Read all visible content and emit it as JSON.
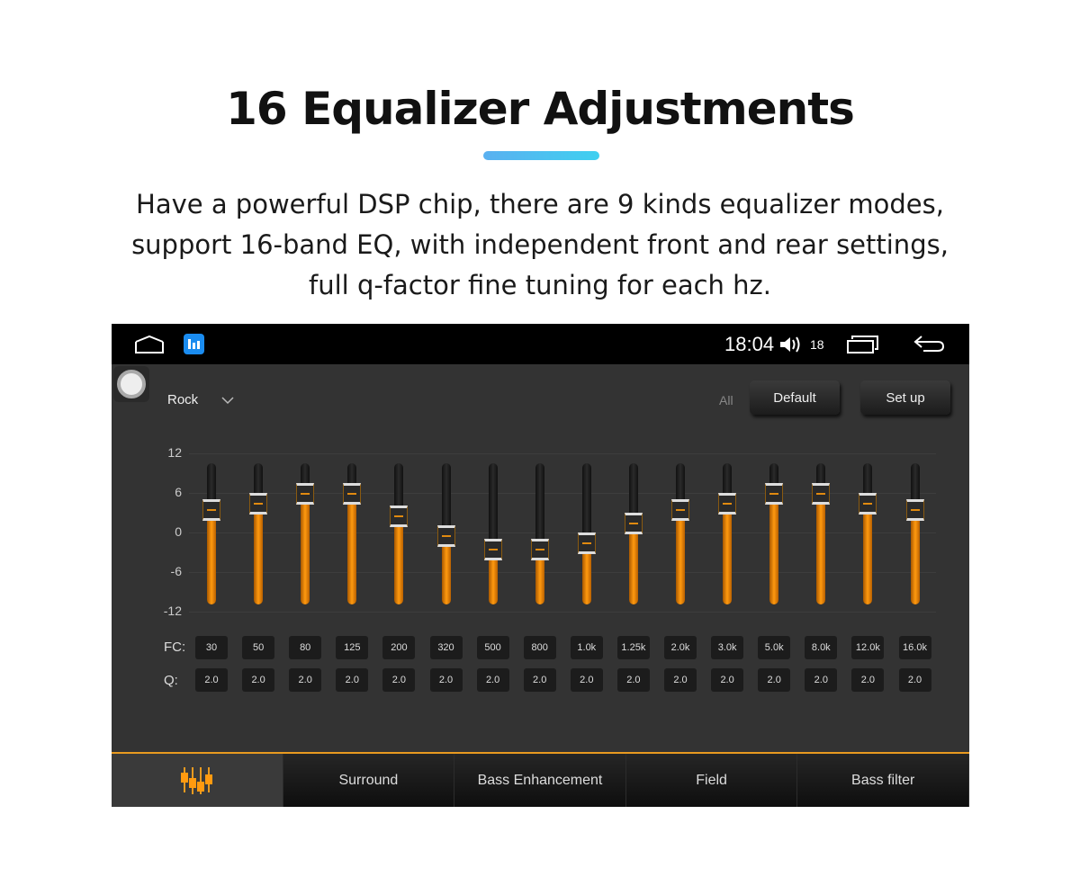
{
  "heading": {
    "title": "16 Equalizer Adjustments",
    "lines": [
      "Have a powerful DSP chip, there are 9 kinds equalizer modes,",
      "support 16-band EQ, with independent front and rear settings,",
      "full q-factor fine tuning for each hz."
    ]
  },
  "status": {
    "time": "18:04",
    "volume": "18",
    "icons": [
      "home-icon",
      "eq-app-icon",
      "volume-icon",
      "recent-apps-icon",
      "back-icon"
    ]
  },
  "controls": {
    "preset": "Rock",
    "all_label": "All",
    "default_label": "Default",
    "setup_label": "Set up"
  },
  "eq": {
    "y_ticks": [
      "12",
      "6",
      "0",
      "-6",
      "-12"
    ],
    "range": [
      -12,
      12
    ],
    "fc_label": "FC:",
    "q_label": "Q:",
    "accent": "#ff9a10",
    "bands": [
      {
        "fc": "30",
        "q": "2.0",
        "gain": 3
      },
      {
        "fc": "50",
        "q": "2.0",
        "gain": 4
      },
      {
        "fc": "80",
        "q": "2.0",
        "gain": 5.5
      },
      {
        "fc": "125",
        "q": "2.0",
        "gain": 5.5
      },
      {
        "fc": "200",
        "q": "2.0",
        "gain": 2
      },
      {
        "fc": "320",
        "q": "2.0",
        "gain": -1
      },
      {
        "fc": "500",
        "q": "2.0",
        "gain": -3
      },
      {
        "fc": "800",
        "q": "2.0",
        "gain": -3
      },
      {
        "fc": "1.0k",
        "q": "2.0",
        "gain": -2
      },
      {
        "fc": "1.25k",
        "q": "2.0",
        "gain": 1
      },
      {
        "fc": "2.0k",
        "q": "2.0",
        "gain": 3
      },
      {
        "fc": "3.0k",
        "q": "2.0",
        "gain": 4
      },
      {
        "fc": "5.0k",
        "q": "2.0",
        "gain": 5.5
      },
      {
        "fc": "8.0k",
        "q": "2.0",
        "gain": 5.5
      },
      {
        "fc": "12.0k",
        "q": "2.0",
        "gain": 4
      },
      {
        "fc": "16.0k",
        "q": "2.0",
        "gain": 3
      }
    ]
  },
  "tabs": [
    {
      "label": "",
      "icon": "equalizer-icon"
    },
    {
      "label": "Surround"
    },
    {
      "label": "Bass Enhancement"
    },
    {
      "label": "Field"
    },
    {
      "label": "Bass filter"
    }
  ]
}
